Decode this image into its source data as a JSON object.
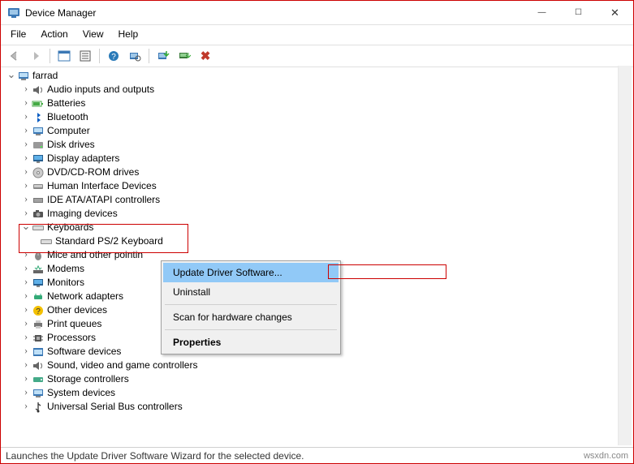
{
  "window": {
    "title": "Device Manager",
    "min": "—",
    "max": "☐",
    "close": "✕"
  },
  "menu": {
    "file": "File",
    "action": "Action",
    "view": "View",
    "help": "Help"
  },
  "root": {
    "label": "farrad"
  },
  "cats": {
    "audio": "Audio inputs and outputs",
    "batt": "Batteries",
    "bt": "Bluetooth",
    "comp": "Computer",
    "disk": "Disk drives",
    "disp": "Display adapters",
    "dvd": "DVD/CD-ROM drives",
    "hid": "Human Interface Devices",
    "ide": "IDE ATA/ATAPI controllers",
    "img": "Imaging devices",
    "kbd": "Keyboards",
    "kbd_item": "Standard PS/2 Keyboard",
    "mice": "Mice and other pointin",
    "modem": "Modems",
    "mon": "Monitors",
    "net": "Network adapters",
    "other": "Other devices",
    "printq": "Print queues",
    "proc": "Processors",
    "soft": "Software devices",
    "sound": "Sound, video and game controllers",
    "stor": "Storage controllers",
    "sys": "System devices",
    "usb": "Universal Serial Bus controllers"
  },
  "ctx": {
    "update": "Update Driver Software...",
    "uninstall": "Uninstall",
    "scan": "Scan for hardware changes",
    "prop": "Properties"
  },
  "status": "Launches the Update Driver Software Wizard for the selected device.",
  "watermark": "wsxdn.com"
}
